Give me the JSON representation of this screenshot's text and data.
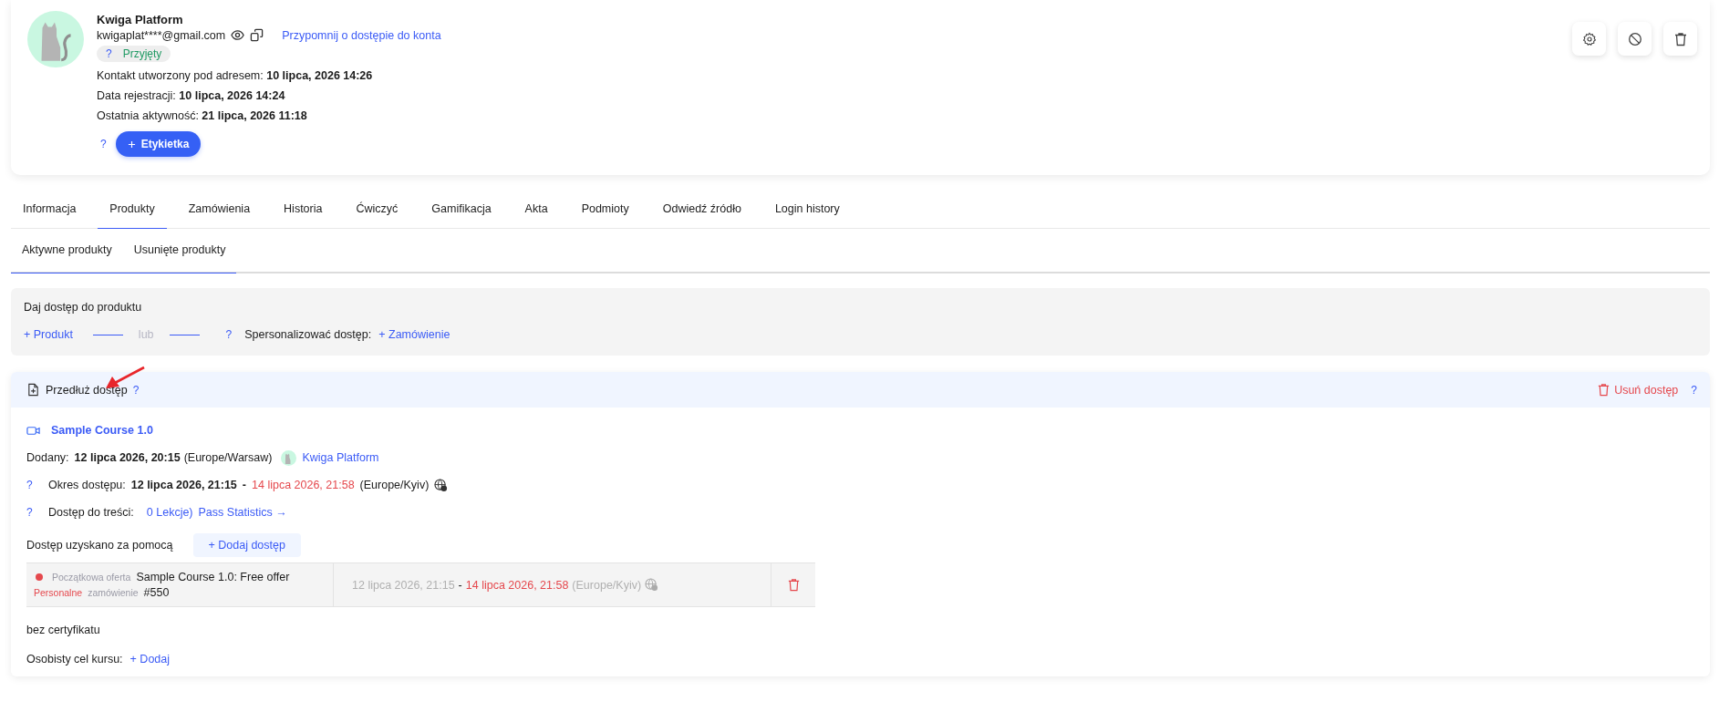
{
  "profile": {
    "name": "Kwiga Platform",
    "email": "kwigaplat****@gmail.com",
    "remind_link": "Przypomnij o dostępie do konta",
    "status": {
      "help": "?",
      "label": "Przyjęty"
    },
    "details": [
      {
        "label": "Kontakt utworzony pod adresem:",
        "value": "10 lipca, 2026 14:26"
      },
      {
        "label": "Data rejestracji:",
        "value": "10 lipca, 2026 14:24"
      },
      {
        "label": "Ostatnia aktywność:",
        "value": "21 lipca, 2026 11:18"
      }
    ],
    "tag_help": "?",
    "tag_button": "Etykietka"
  },
  "tabs": [
    {
      "label": "Informacja",
      "selected": false
    },
    {
      "label": "Produkty",
      "selected": true
    },
    {
      "label": "Zamówienia",
      "selected": false
    },
    {
      "label": "Historia",
      "selected": false
    },
    {
      "label": "Ćwiczyć",
      "selected": false
    },
    {
      "label": "Gamifikacja",
      "selected": false
    },
    {
      "label": "Akta",
      "selected": false
    },
    {
      "label": "Podmioty",
      "selected": false
    },
    {
      "label": "Odwiedź źródło",
      "selected": false
    },
    {
      "label": "Login history",
      "selected": false
    }
  ],
  "subtabs": [
    {
      "label": "Aktywne produkty",
      "selected": true
    },
    {
      "label": "Usunięte produkty",
      "selected": true
    }
  ],
  "grant": {
    "title": "Daj dostęp do produktu",
    "product_link": "+ Produkt",
    "or": "lub",
    "help": "?",
    "personalize_label": "Spersonalizować dostęp:",
    "order_link": "+ Zamówienie"
  },
  "access": {
    "title": "Przedłuż dostęp",
    "help": "?",
    "remove": "Usuń dostęp",
    "remove_help": "?",
    "course": "Sample Course 1.0",
    "added_label": "Dodany:",
    "added_date": "12 lipca 2026, 20:15",
    "added_tz": "(Europe/Warsaw)",
    "added_by": "Kwiga Platform",
    "period_help": "?",
    "period_label": "Okres dostępu:",
    "period_start": "12 lipca 2026, 21:15",
    "period_sep": "-",
    "period_end": "14 lipca 2026, 21:58",
    "period_tz": "(Europe/Kyiv)",
    "content_help": "?",
    "content_label": "Dostęp do treści:",
    "lessons": "0 Lekcje)",
    "stats": "Pass Statistics →",
    "via_label": "Dostęp uzyskano za pomocą",
    "add_access": "+ Dodaj dostęp",
    "grants": [
      {
        "color": "#e5484d",
        "offer_label": "Początkowa oferta",
        "offer": "Sample Course 1.0: Free offer",
        "order_kind": "Personalne",
        "order_label": "zamówienie",
        "order_no": "#550",
        "start": "12 lipca 2026, 21:15",
        "sep": "-",
        "end": "14 lipca 2026, 21:58",
        "tz": "(Europe/Kyiv)"
      }
    ],
    "certificate": "bez certyfikatu",
    "goal_label": "Osobisty cel kursu:",
    "goal_add": "+ Dodaj"
  }
}
